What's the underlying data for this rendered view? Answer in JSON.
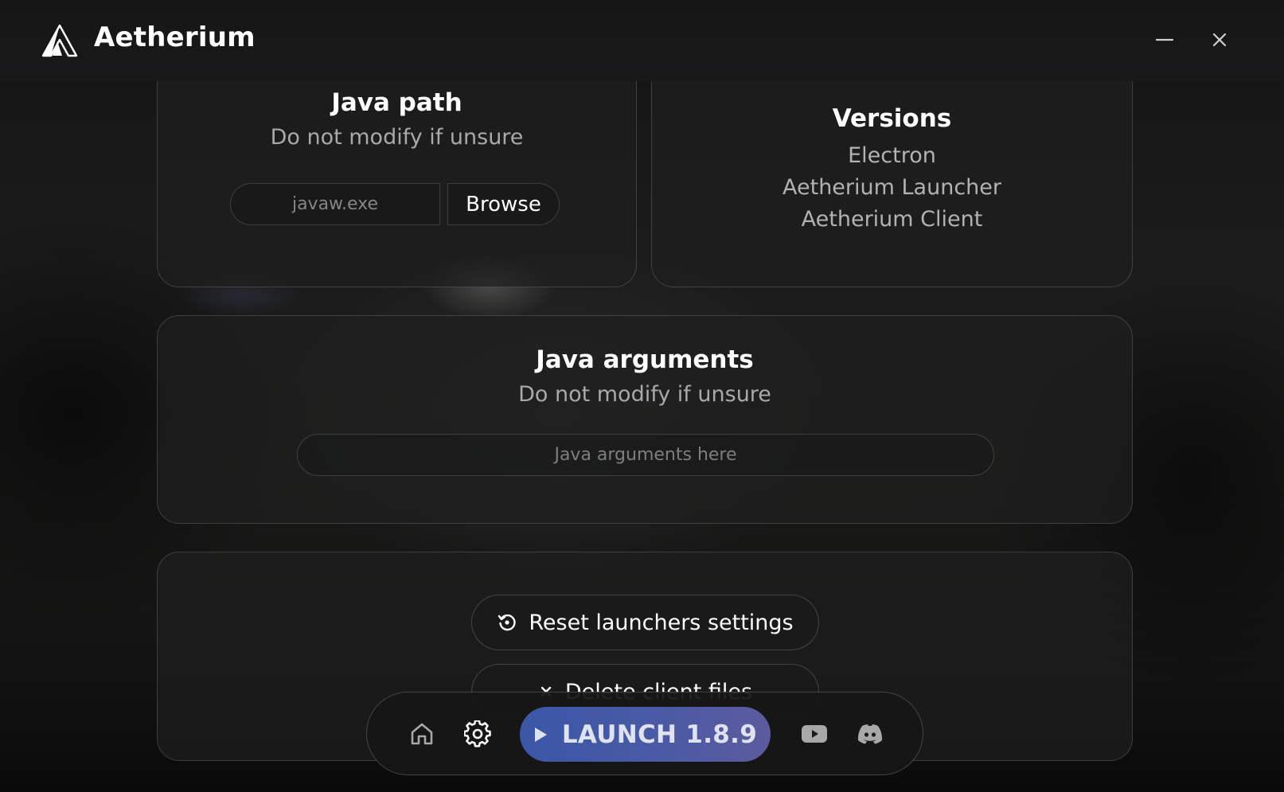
{
  "app": {
    "title": "Aetherium"
  },
  "window_controls": {
    "minimize_icon": "minimize-icon",
    "close_icon": "close-icon"
  },
  "java_path": {
    "title": "Java path",
    "subtitle": "Do not modify if unsure",
    "input_value": "",
    "input_placeholder": "javaw.exe",
    "browse_label": "Browse"
  },
  "versions": {
    "title": "Versions",
    "items": [
      "Electron",
      "Aetherium Launcher",
      "Aetherium Client"
    ]
  },
  "java_arguments": {
    "title": "Java arguments",
    "subtitle": "Do not modify if unsure",
    "input_value": "",
    "input_placeholder": "Java arguments here"
  },
  "actions": {
    "reset_label": "Reset launchers settings",
    "reset_icon": "reset-icon",
    "delete_label": "Delete client files",
    "delete_icon": "close-icon"
  },
  "dock": {
    "home_icon": "home-icon",
    "settings_icon": "gear-icon",
    "launch_label": "LAUNCH 1.8.9",
    "launch_icon": "play-icon",
    "youtube_icon": "youtube-icon",
    "discord_icon": "discord-icon"
  },
  "colors": {
    "accent_start": "#3a57a6",
    "accent_end": "#5c5b9e",
    "background": "#1a1a1b",
    "muted_text": "#a9a9a9"
  }
}
